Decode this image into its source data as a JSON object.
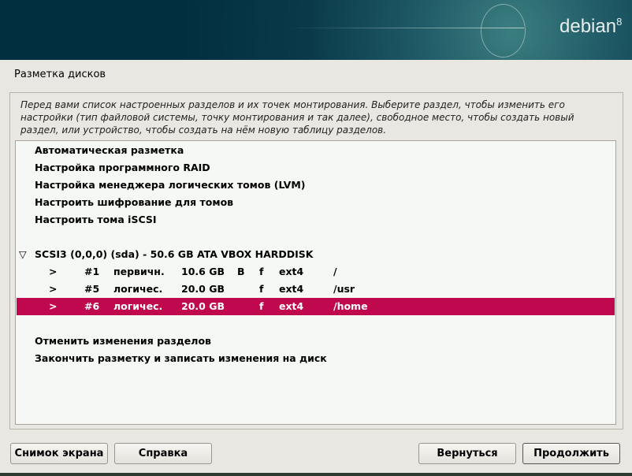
{
  "header": {
    "logo_text": "debian",
    "logo_version": "8"
  },
  "page_title": "Разметка дисков",
  "description": "Перед вами список настроенных разделов и их точек монтирования. Выберите раздел, чтобы изменить его настройки (тип файловой системы, точку монтирования и так далее), свободное место, чтобы создать новый раздел, или устройство, чтобы создать на нём новую таблицу разделов.",
  "menu": [
    "Автоматическая разметка",
    "Настройка программного RAID",
    "Настройка менеджера логических томов (LVM)",
    "Настроить шифрование для томов",
    "Настроить тома iSCSI"
  ],
  "disk": {
    "expander": "▽",
    "label": "SCSI3 (0,0,0) (sda) - 50.6 GB ATA VBOX HARDDISK"
  },
  "partitions": [
    {
      "arrow": ">",
      "num": "#1",
      "type": "первичн.",
      "size": "10.6 GB",
      "boot": "B",
      "fmt": "f",
      "fs": "ext4",
      "mount": "/"
    },
    {
      "arrow": ">",
      "num": "#5",
      "type": "логичес.",
      "size": "20.0 GB",
      "boot": "",
      "fmt": "f",
      "fs": "ext4",
      "mount": "/usr"
    },
    {
      "arrow": ">",
      "num": "#6",
      "type": "логичес.",
      "size": "20.0 GB",
      "boot": "",
      "fmt": "f",
      "fs": "ext4",
      "mount": "/home"
    }
  ],
  "actions": [
    "Отменить изменения разделов",
    "Закончить разметку и записать изменения на диск"
  ],
  "buttons": {
    "screenshot": "Снимок экрана",
    "help": "Справка",
    "back": "Вернуться",
    "continue": "Продолжить"
  }
}
